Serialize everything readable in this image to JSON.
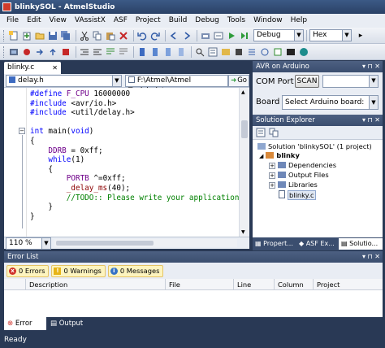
{
  "window": {
    "title": "blinkySOL - AtmelStudio"
  },
  "menu": [
    "File",
    "Edit",
    "View",
    "VAssistX",
    "ASF",
    "Project",
    "Build",
    "Debug",
    "Tools",
    "Window",
    "Help"
  ],
  "toolbar": {
    "config": "Debug",
    "format": "Hex"
  },
  "editor": {
    "tab_label": "blinky.c",
    "nav_left": "delay.h",
    "nav_right": "F:\\Atmel\\Atmel Toolchain\\",
    "nav_go": "Go",
    "zoom": "110 %",
    "lines": [
      [
        {
          "t": "#define ",
          "c": "pp"
        },
        {
          "t": "F_CPU",
          "c": "mac"
        },
        {
          "t": " 16000000",
          "c": ""
        }
      ],
      [
        {
          "t": "#include ",
          "c": "pp"
        },
        {
          "t": "<avr/io.h>",
          "c": ""
        }
      ],
      [
        {
          "t": "#include ",
          "c": "pp"
        },
        {
          "t": "<util/delay.h>",
          "c": ""
        }
      ],
      [],
      [
        {
          "t": "int",
          "c": "kw"
        },
        {
          "t": " main(",
          "c": ""
        },
        {
          "t": "void",
          "c": "kw"
        },
        {
          "t": ")",
          "c": ""
        }
      ],
      [
        {
          "t": "{",
          "c": ""
        }
      ],
      [
        {
          "t": "    ",
          "c": ""
        },
        {
          "t": "DDRB",
          "c": "mac"
        },
        {
          "t": " = 0xff;",
          "c": ""
        }
      ],
      [
        {
          "t": "    ",
          "c": ""
        },
        {
          "t": "while",
          "c": "kw"
        },
        {
          "t": "(1)",
          "c": ""
        }
      ],
      [
        {
          "t": "    {",
          "c": ""
        }
      ],
      [
        {
          "t": "        ",
          "c": ""
        },
        {
          "t": "PORTB",
          "c": "mac"
        },
        {
          "t": " ^=0xff;",
          "c": ""
        }
      ],
      [
        {
          "t": "        ",
          "c": ""
        },
        {
          "t": "_delay_ms",
          "c": "fn"
        },
        {
          "t": "(40);",
          "c": ""
        }
      ],
      [
        {
          "t": "        ",
          "c": ""
        },
        {
          "t": "//TODO:: Please write your application",
          "c": "cm"
        }
      ],
      [
        {
          "t": "    }",
          "c": ""
        }
      ],
      [
        {
          "t": "}",
          "c": ""
        }
      ]
    ]
  },
  "avr_panel": {
    "title": "AVR on Arduino",
    "com_port_label": "COM Port",
    "scan_label": "SCAN",
    "board_label": "Board",
    "board_select": "Select Arduino board:"
  },
  "solution": {
    "title": "Solution Explorer",
    "root": "Solution 'blinkySOL' (1 project)",
    "project": "blinky",
    "items": [
      "Dependencies",
      "Output Files",
      "Libraries",
      "blinky.c"
    ],
    "tabs": [
      "Propert...",
      "ASF Ex...",
      "Solutio..."
    ]
  },
  "error_list": {
    "title": "Error List",
    "errors": "0 Errors",
    "warnings": "0 Warnings",
    "messages": "0 Messages",
    "columns": [
      "Description",
      "File",
      "Line",
      "Column",
      "Project"
    ]
  },
  "bottom_tabs": [
    "Error List",
    "Output"
  ],
  "status": "Ready",
  "colors": {
    "chrome": "#293955",
    "accent": "#4d6082"
  }
}
